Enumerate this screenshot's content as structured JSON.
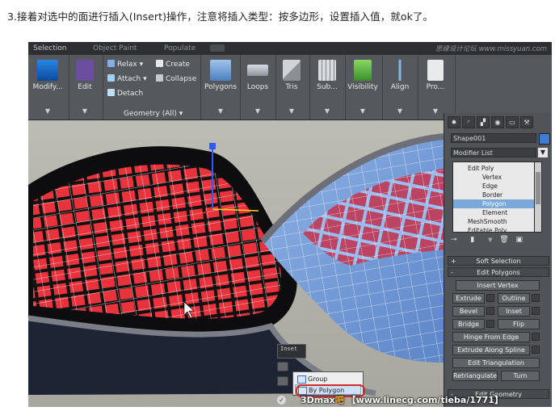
{
  "caption": "3.接着对选中的面进行插入(Insert)操作，注意将插入类型：按多边形，设置插入值，就ok了。",
  "tabs": [
    {
      "label": "Selection",
      "selected": true
    },
    {
      "label": "Object Paint",
      "selected": false
    },
    {
      "label": "Populate",
      "selected": false
    }
  ],
  "top_watermark": "思缘设计论坛 www.missyuan.com",
  "ribbon": {
    "modify": "Modify...",
    "edit": "Edit",
    "relax": "Relax",
    "attach": "Attach",
    "detach": "Detach",
    "create": "Create",
    "collapse": "Collapse",
    "geometry_group": "Geometry (All)",
    "polygons": "Polygons",
    "loops": "Loops",
    "tris": "Tris",
    "subdivision": "Sub...",
    "visibility": "Visibility",
    "align": "Align",
    "properties": "Pro..."
  },
  "panel": {
    "object_name": "Shape001",
    "modifier_list": "Modifier List",
    "stack": [
      "Edit Poly",
      "Vertex",
      "Edge",
      "Border",
      "Polygon",
      "Element",
      "MeshSmooth",
      "Editable Poly"
    ],
    "selected_stack_item": "Polygon",
    "rollout_soft": "Soft Selection",
    "rollout_edit_polygons": "Edit Polygons",
    "insert_vertex": "Insert Vertex",
    "extrude": "Extrude",
    "outline": "Outline",
    "bevel": "Bevel",
    "inset": "Inset",
    "bridge": "Bridge",
    "flip": "Flip",
    "hinge": "Hinge From Edge",
    "extrude_spline": "Extrude Along Spline",
    "edit_triangulation": "Edit Triangulation",
    "retriangulate": "Retriangulate",
    "turn": "Turn",
    "rollout_edit_geometry": "Edit Geometry"
  },
  "caddy": {
    "title": "Inset",
    "menu": [
      "Group",
      "By Polygon"
    ],
    "highlighted": "By Polygon"
  },
  "bottom_watermark": {
    "brand": "3Dmax",
    "cn": "吧",
    "url": "【www.linecg.com/tieba/1771】"
  },
  "colors": {
    "selected_face": "#e8323c",
    "mesh_blue": "#7aa3e0",
    "selection_outline": "#d42a2a"
  }
}
